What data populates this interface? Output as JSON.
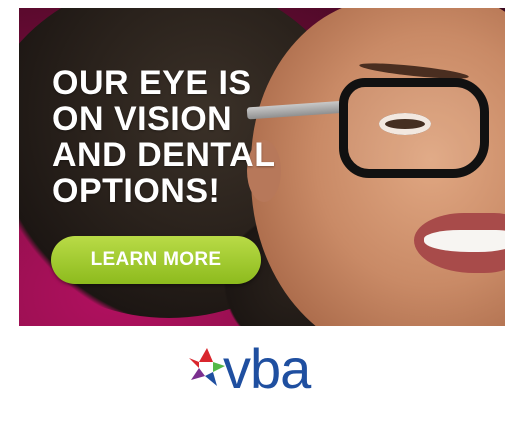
{
  "ad": {
    "headline_lines": [
      "OUR EYE IS",
      "ON VISION",
      "AND DENTAL",
      "OPTIONS!"
    ],
    "cta_label": "LEARN MORE",
    "logo_text": "vba",
    "colors": {
      "cta": "#a3cb2e",
      "background": "#8e0f4a",
      "logo": "#1f4fa0",
      "star_red": "#d9262d",
      "star_green": "#55b948",
      "star_blue": "#1f4fa0",
      "star_purple": "#7b2f8f"
    }
  }
}
